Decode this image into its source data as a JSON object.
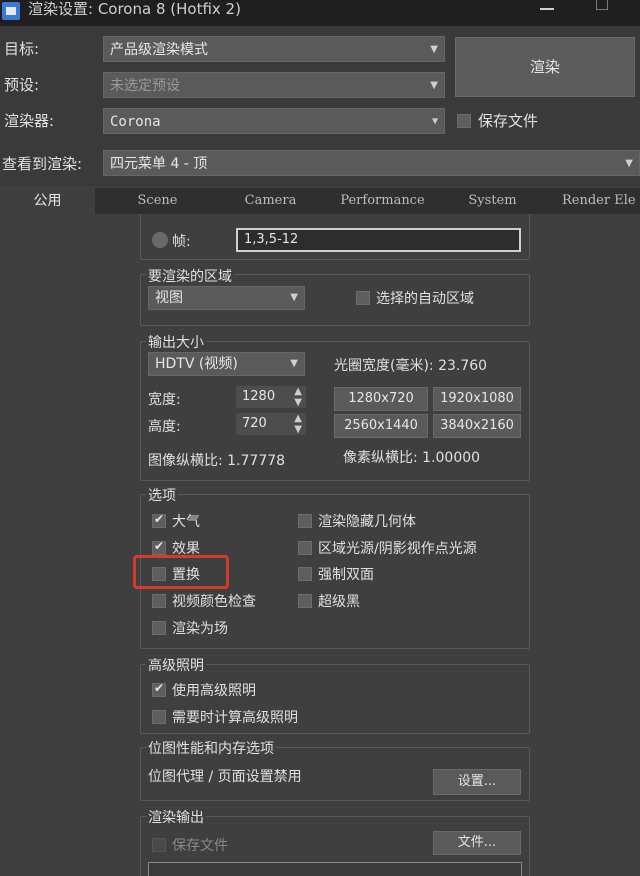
{
  "window": {
    "title": "渲染设置: Corona 8 (Hotfix 2)"
  },
  "top": {
    "target_label": "目标:",
    "target_value": "产品级渲染模式",
    "preset_label": "预设:",
    "preset_value": "未选定预设",
    "renderer_label": "渲染器:",
    "renderer_value": "Corona",
    "save_file_label": "保存文件",
    "view_label": "查看到渲染:",
    "view_value": "四元菜单 4 - 顶",
    "render_button": "渲染"
  },
  "tabs": [
    "公用",
    "Scene",
    "Camera",
    "Performance",
    "System",
    "Render Ele"
  ],
  "frames": {
    "label": "帧:",
    "value": "1,3,5-12"
  },
  "area": {
    "title": "要渲染的区域",
    "dropdown": "视图",
    "auto_region_label": "选择的自动区域"
  },
  "output": {
    "title": "输出大小",
    "preset": "HDTV (视频)",
    "aperture": "光圈宽度(毫米): 23.760",
    "width_label": "宽度:",
    "width_value": "1280",
    "height_label": "高度:",
    "height_value": "720",
    "presets": [
      "1280x720",
      "1920x1080",
      "2560x1440",
      "3840x2160"
    ],
    "image_aspect": "图像纵横比: 1.77778",
    "pixel_aspect": "像素纵横比: 1.00000"
  },
  "options": {
    "title": "选项",
    "items_left": [
      {
        "label": "大气",
        "checked": true
      },
      {
        "label": "效果",
        "checked": true
      },
      {
        "label": "置换",
        "checked": false
      },
      {
        "label": "视频颜色检查",
        "checked": false
      },
      {
        "label": "渲染为场",
        "checked": false
      }
    ],
    "items_right": [
      {
        "label": "渲染隐藏几何体",
        "checked": false
      },
      {
        "label": "区域光源/阴影视作点光源",
        "checked": false
      },
      {
        "label": "强制双面",
        "checked": false
      },
      {
        "label": "超级黑",
        "checked": false
      }
    ]
  },
  "advanced_lighting": {
    "title": "高级照明",
    "use_label": "使用高级照明",
    "compute_label": "需要时计算高级照明"
  },
  "bitmap": {
    "title": "位图性能和内存选项",
    "proxy_text": "位图代理 / 页面设置禁用",
    "setup_button": "设置..."
  },
  "render_output": {
    "title": "渲染输出",
    "save_file_label": "保存文件",
    "files_button": "文件..."
  },
  "colors": {
    "highlight": "#d53b2b",
    "background": "#3f3f3f"
  }
}
